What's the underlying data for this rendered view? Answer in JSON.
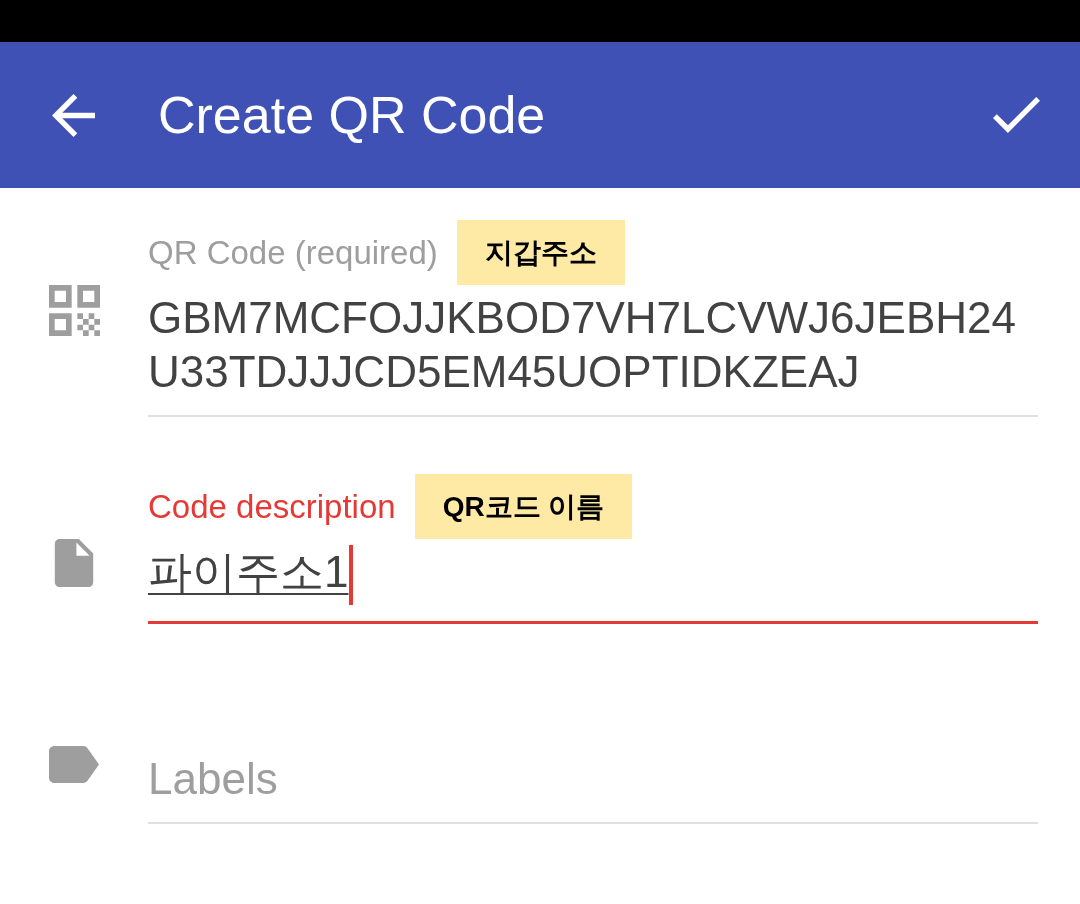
{
  "app_bar": {
    "title": "Create QR Code"
  },
  "fields": [
    {
      "label": "QR Code (required)",
      "annotation": "지갑주소",
      "value": "GBM7MCFOJJKBOD7VH7LCVWJ6JEBH24U33TDJJJCD5EM45UOPTIDKZEAJ",
      "focused": false,
      "composing": false
    },
    {
      "label": "Code description",
      "annotation": "QR코드 이름",
      "value": "파이주소1",
      "focused": true,
      "composing": true
    },
    {
      "placeholder": "Labels",
      "focused": false,
      "composing": false
    }
  ]
}
